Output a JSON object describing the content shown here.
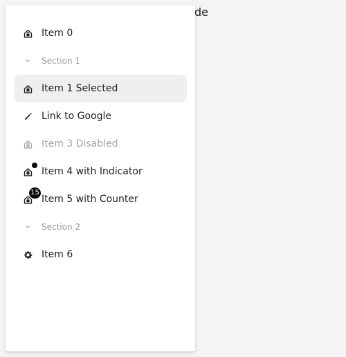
{
  "background": {
    "text_fragment": "de"
  },
  "drawer": {
    "items": [
      {
        "kind": "item",
        "label": "Item 0",
        "icon": "home-lock-icon"
      },
      {
        "kind": "section",
        "label": "Section 1",
        "icon": "chevron-down-icon"
      },
      {
        "kind": "item",
        "label": "Item 1 Selected",
        "icon": "home-lock-icon",
        "selected": true
      },
      {
        "kind": "item",
        "label": "Link to Google",
        "icon": "pencil-icon"
      },
      {
        "kind": "item",
        "label": "Item 3 Disabled",
        "icon": "home-lock-icon",
        "disabled": true
      },
      {
        "kind": "item",
        "label": "Item 4 with Indicator",
        "icon": "home-lock-icon",
        "indicator": true
      },
      {
        "kind": "item",
        "label": "Item 5 with Counter",
        "icon": "home-lock-icon",
        "counter": "15"
      },
      {
        "kind": "section",
        "label": "Section 2",
        "icon": "chevron-down-icon"
      },
      {
        "kind": "item",
        "label": "Item 6",
        "icon": "gear-icon"
      }
    ]
  },
  "colors": {
    "page_background": "#f4f4f4",
    "drawer_background": "#ffffff",
    "selected_background": "#efefef",
    "text": "#1f1f1f",
    "disabled_text": "#a7a7a7",
    "section_text": "#9a9a9a",
    "badge_background": "#0b0b0b"
  }
}
